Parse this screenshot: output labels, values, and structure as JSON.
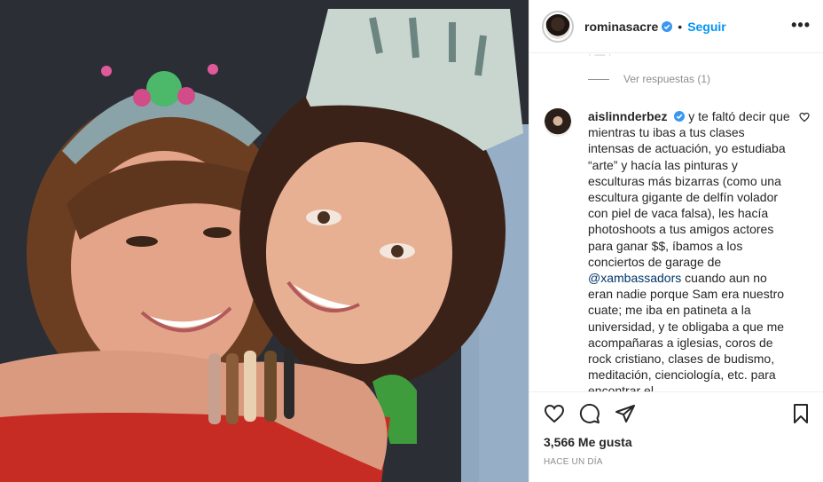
{
  "post": {
    "username": "rominasacre",
    "separator": "•",
    "follow_label": "Seguir",
    "more_label": "•••"
  },
  "comments": {
    "faded_text": "· — ·",
    "view_replies": "Ver respuestas (1)",
    "comment": {
      "username": "aislinnderbez",
      "text_before_mention": "y te faltó decir que mientras tu ibas a tus clases intensas de actuación, yo estudiaba “arte” y hacía las pinturas y esculturas más bizarras (como una escultura gigante de delfín volador con piel de vaca falsa), les hacía photoshoots a tus amigos actores para ganar $$, íbamos a los conciertos de garage de ",
      "mention": "@xambassadors",
      "text_after_mention": " cuando aun no eran nadie porque Sam era nuestro cuate; me iba en patineta a la universidad, y te obligaba a que me acompañaras a iglesias, coros de rock cristiano, clases de budismo, meditación, cienciología, etc. para encontrar el"
    }
  },
  "footer": {
    "likes": "3,566 Me gusta",
    "timestamp": "HACE UN DÍA"
  },
  "icons": {
    "verified": "verified-badge-icon",
    "like": "heart-icon",
    "comment": "comment-icon",
    "share": "paper-plane-icon",
    "save": "bookmark-icon"
  },
  "colors": {
    "accent": "#0095f6",
    "verified": "#3897f0",
    "mention": "#00376b",
    "muted": "#8e8e8e"
  }
}
